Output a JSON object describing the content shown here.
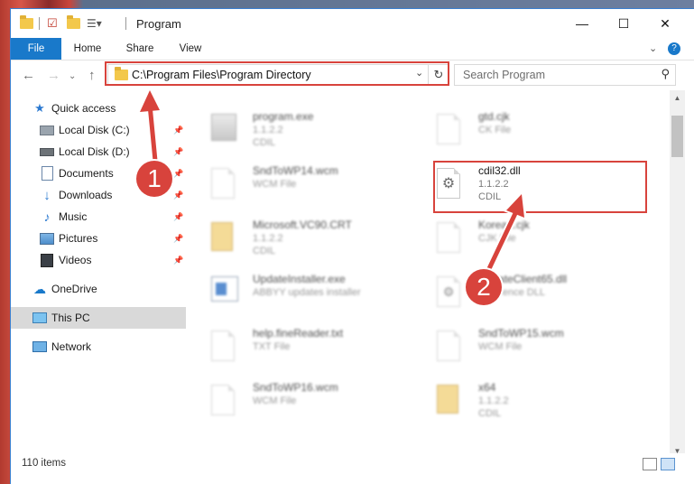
{
  "titlebar": {
    "title": "Program",
    "minimize": "—",
    "maximize": "☐",
    "close": "✕"
  },
  "ribbon": {
    "tabs": [
      {
        "label": "File"
      },
      {
        "label": "Home"
      },
      {
        "label": "Share"
      },
      {
        "label": "View"
      }
    ]
  },
  "address": {
    "path": "C:\\Program Files\\Program Directory",
    "search_placeholder": "Search Program"
  },
  "nav": {
    "items": [
      {
        "label": "Quick access",
        "icon": "star-icon"
      },
      {
        "label": "Local Disk (C:)",
        "icon": "drive-icon"
      },
      {
        "label": "Local Disk (D:)",
        "icon": "drive-icon"
      },
      {
        "label": "Documents",
        "icon": "documents-icon"
      },
      {
        "label": "Downloads",
        "icon": "download-arrow-icon"
      },
      {
        "label": "Music",
        "icon": "music-note-icon"
      },
      {
        "label": "Pictures",
        "icon": "pictures-icon"
      },
      {
        "label": "Videos",
        "icon": "film-icon"
      },
      {
        "label": "OneDrive",
        "icon": "cloud-icon"
      },
      {
        "label": "This PC",
        "icon": "monitor-icon"
      },
      {
        "label": "Network",
        "icon": "network-icon"
      }
    ]
  },
  "files": {
    "left": [
      {
        "name": "program.exe",
        "line1": "1.1.2.2",
        "line2": "CDIL"
      },
      {
        "name": "SndToWP14.wcm",
        "line1": "WCM File",
        "line2": ""
      },
      {
        "name": "Microsoft.VC90.CRT",
        "line1": "1.1.2.2",
        "line2": "CDIL"
      },
      {
        "name": "UpdateInstaller.exe",
        "line1": "ABBYY updates installer",
        "line2": ""
      },
      {
        "name": "help.fineReader.txt",
        "line1": "TXT File",
        "line2": ""
      },
      {
        "name": "SndToWP16.wcm",
        "line1": "WCM File",
        "line2": ""
      }
    ],
    "right": [
      {
        "name": "gtd.cjk",
        "line1": "CK File",
        "line2": ""
      },
      {
        "name": "cdil32.dll",
        "line1": "1.1.2.2",
        "line2": "CDIL"
      },
      {
        "name": "Korean.cjk",
        "line1": "CJK File",
        "line2": ""
      },
      {
        "name": "UpdateClient65.dll",
        "line1": "Reference DLL",
        "line2": ""
      },
      {
        "name": "SndToWP15.wcm",
        "line1": "WCM File",
        "line2": ""
      },
      {
        "name": "x64",
        "line1": "1.1.2.2",
        "line2": "CDIL"
      }
    ]
  },
  "status": {
    "count": "110 items"
  },
  "annotations": {
    "step1": "1",
    "step2": "2",
    "color": "#d8433c"
  }
}
